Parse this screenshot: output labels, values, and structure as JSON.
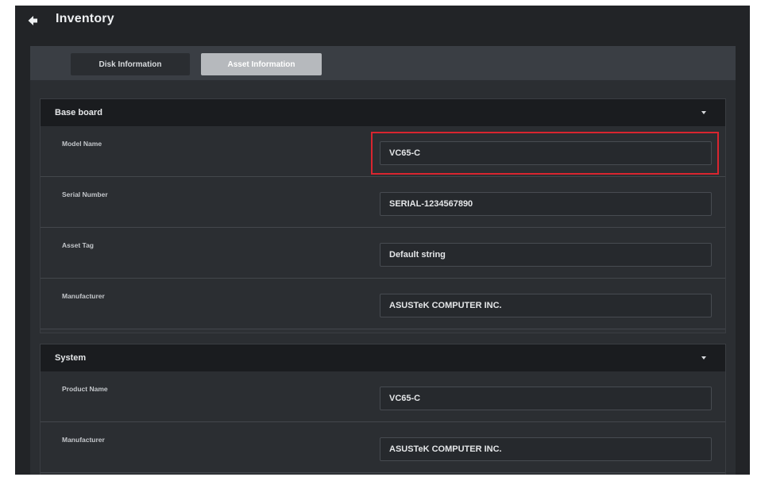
{
  "header": {
    "title": "Inventory",
    "back_icon": "arrow-left-icon"
  },
  "tabs": [
    {
      "label": "Disk Information",
      "active": false
    },
    {
      "label": "Asset Information",
      "active": true
    }
  ],
  "sections": [
    {
      "title": "Base board",
      "caret_icon": "caret-down-icon",
      "rows": [
        {
          "label": "Model Name",
          "value": "VC65-C",
          "highlighted": true
        },
        {
          "label": "Serial Number",
          "value": "SERIAL-1234567890"
        },
        {
          "label": "Asset Tag",
          "value": "Default string"
        },
        {
          "label": "Manufacturer",
          "value": "ASUSTeK COMPUTER INC."
        }
      ]
    },
    {
      "title": "System",
      "caret_icon": "caret-down-icon",
      "rows": [
        {
          "label": "Product Name",
          "value": "VC65-C"
        },
        {
          "label": "Manufacturer",
          "value": "ASUSTeK COMPUTER INC."
        }
      ]
    }
  ],
  "colors": {
    "background": "#222427",
    "panel": "#2b2e32",
    "section_header": "#1a1c1f",
    "active_tab": "#b6b9bd",
    "highlight": "#d9252f"
  }
}
